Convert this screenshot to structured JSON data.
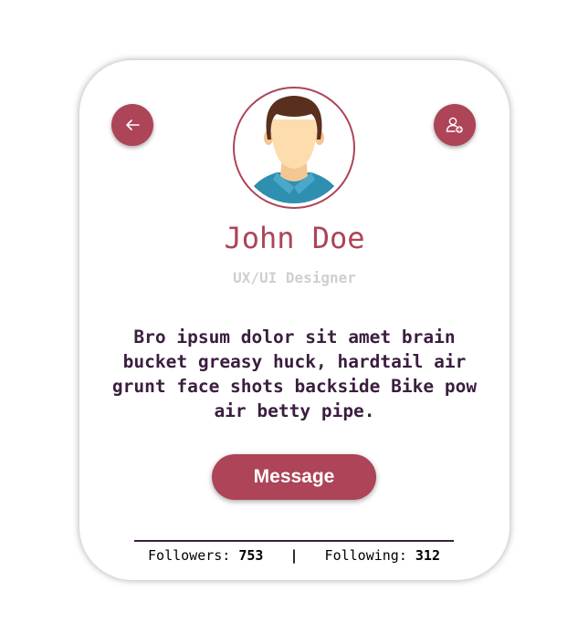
{
  "colors": {
    "accent": "#ad4458",
    "text_dark": "#3a1e3e",
    "subtitle": "#cfcfcf",
    "card_bg": "#ffffff"
  },
  "header": {
    "back_icon": "arrow-left-icon",
    "add_icon": "add-user-icon"
  },
  "profile": {
    "name": "John Doe",
    "title": "UX/UI Designer",
    "bio": "Bro ipsum dolor sit amet brain bucket greasy huck, hardtail air grunt face shots backside Bike pow air betty pipe."
  },
  "actions": {
    "message_label": "Message"
  },
  "stats": {
    "followers_label": "Followers:",
    "followers_count": "753",
    "separator": "|",
    "following_label": "Following:",
    "following_count": "312"
  }
}
